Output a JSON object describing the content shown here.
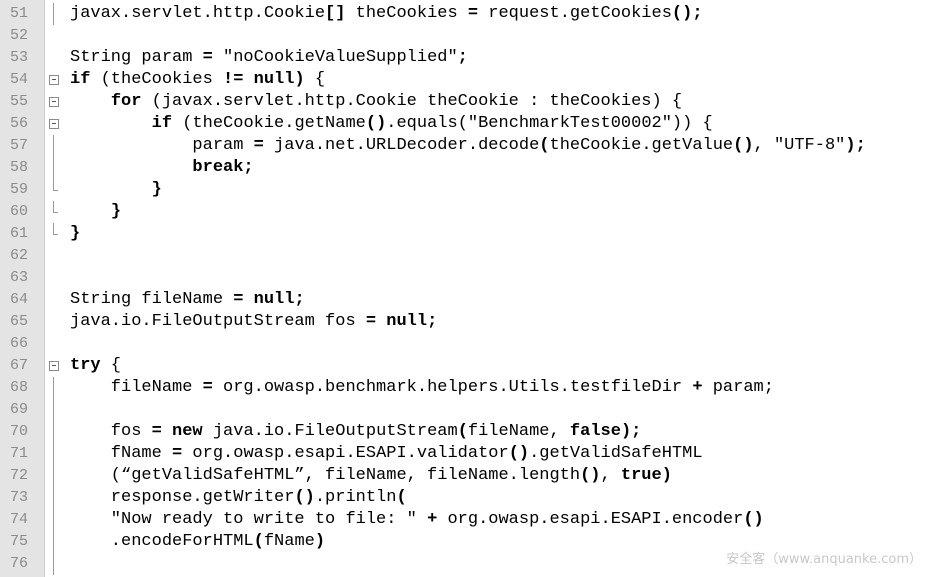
{
  "editor": {
    "watermark": "安全客（www.anquanke.com）",
    "lines": [
      {
        "num": "51",
        "fold": "vline",
        "segs": [
          {
            "t": "javax.servlet.http.Cookie"
          },
          {
            "t": "[]",
            "b": true
          },
          {
            "t": " theCookies "
          },
          {
            "t": "=",
            "b": true
          },
          {
            "t": " request.getCookies"
          },
          {
            "t": "();",
            "b": true
          }
        ]
      },
      {
        "num": "52",
        "fold": "",
        "segs": []
      },
      {
        "num": "53",
        "fold": "",
        "segs": [
          {
            "t": "String param "
          },
          {
            "t": "=",
            "b": true
          },
          {
            "t": " \"noCookieValueSupplied\""
          },
          {
            "t": ";",
            "b": true
          }
        ]
      },
      {
        "num": "54",
        "fold": "box",
        "segs": [
          {
            "t": "if",
            "b": true
          },
          {
            "t": " (theCookies "
          },
          {
            "t": "!=",
            "b": true
          },
          {
            "t": " "
          },
          {
            "t": "null",
            "b": true
          },
          {
            "t": ")",
            "b": true
          },
          {
            "t": " {"
          }
        ]
      },
      {
        "num": "55",
        "fold": "box",
        "segs": [
          {
            "t": "    "
          },
          {
            "t": "for",
            "b": true
          },
          {
            "t": " (javax.servlet.http.Cookie theCookie : theCookies) {"
          }
        ]
      },
      {
        "num": "56",
        "fold": "box",
        "segs": [
          {
            "t": "        "
          },
          {
            "t": "if",
            "b": true
          },
          {
            "t": " (theCookie.getName"
          },
          {
            "t": "()",
            "b": true
          },
          {
            "t": ".equals(\"BenchmarkTest00002\"))"
          },
          {
            "t": " {"
          }
        ]
      },
      {
        "num": "57",
        "fold": "vline",
        "segs": [
          {
            "t": "            param "
          },
          {
            "t": "=",
            "b": true
          },
          {
            "t": " java.net.URLDecoder.decode"
          },
          {
            "t": "(",
            "b": true
          },
          {
            "t": "theCookie.getValue"
          },
          {
            "t": "()",
            "b": true
          },
          {
            "t": ", \"UTF-8\""
          },
          {
            "t": ");",
            "b": true
          }
        ]
      },
      {
        "num": "58",
        "fold": "vline",
        "segs": [
          {
            "t": "            "
          },
          {
            "t": "break;",
            "b": true
          }
        ]
      },
      {
        "num": "59",
        "fold": "end",
        "segs": [
          {
            "t": "        "
          },
          {
            "t": "}",
            "b": true
          }
        ]
      },
      {
        "num": "60",
        "fold": "end",
        "segs": [
          {
            "t": "    "
          },
          {
            "t": "}",
            "b": true
          }
        ]
      },
      {
        "num": "61",
        "fold": "end",
        "segs": [
          {
            "t": "}",
            "b": true
          }
        ]
      },
      {
        "num": "62",
        "fold": "",
        "segs": []
      },
      {
        "num": "63",
        "fold": "",
        "segs": []
      },
      {
        "num": "64",
        "fold": "",
        "segs": [
          {
            "t": "String fileName "
          },
          {
            "t": "=",
            "b": true
          },
          {
            "t": " "
          },
          {
            "t": "null;",
            "b": true
          }
        ]
      },
      {
        "num": "65",
        "fold": "",
        "segs": [
          {
            "t": "java.io.FileOutputStream fos "
          },
          {
            "t": "=",
            "b": true
          },
          {
            "t": " "
          },
          {
            "t": "null;",
            "b": true
          }
        ]
      },
      {
        "num": "66",
        "fold": "",
        "segs": []
      },
      {
        "num": "67",
        "fold": "box",
        "segs": [
          {
            "t": "try",
            "b": true
          },
          {
            "t": " {"
          }
        ]
      },
      {
        "num": "68",
        "fold": "vline",
        "segs": [
          {
            "t": "    fileName "
          },
          {
            "t": "=",
            "b": true
          },
          {
            "t": " org.owasp.benchmark.helpers.Utils.testfileDir "
          },
          {
            "t": "+",
            "b": true
          },
          {
            "t": " param;"
          }
        ]
      },
      {
        "num": "69",
        "fold": "vline",
        "segs": []
      },
      {
        "num": "70",
        "fold": "vline",
        "segs": [
          {
            "t": "    fos "
          },
          {
            "t": "=",
            "b": true
          },
          {
            "t": " "
          },
          {
            "t": "new",
            "b": true
          },
          {
            "t": " java.io.FileOutputStream"
          },
          {
            "t": "(",
            "b": true
          },
          {
            "t": "fileName, "
          },
          {
            "t": "false",
            "b": true
          },
          {
            "t": ");",
            "b": true
          }
        ]
      },
      {
        "num": "71",
        "fold": "vline",
        "segs": [
          {
            "t": "    fName "
          },
          {
            "t": "=",
            "b": true
          },
          {
            "t": " org.owasp.esapi.ESAPI.validator"
          },
          {
            "t": "()",
            "b": true
          },
          {
            "t": ".getValidSafeHTML"
          }
        ]
      },
      {
        "num": "72",
        "fold": "vline",
        "segs": [
          {
            "t": "    (“getValidSafeHTML”, fileName, fileName.length"
          },
          {
            "t": "()",
            "b": true
          },
          {
            "t": ", "
          },
          {
            "t": "true",
            "b": true
          },
          {
            "t": ")",
            "b": true
          }
        ]
      },
      {
        "num": "73",
        "fold": "vline",
        "segs": [
          {
            "t": "    response.getWriter"
          },
          {
            "t": "()",
            "b": true
          },
          {
            "t": ".println"
          },
          {
            "t": "(",
            "b": true
          }
        ]
      },
      {
        "num": "74",
        "fold": "vline",
        "segs": [
          {
            "t": "    \"Now ready to write to file: \" "
          },
          {
            "t": "+",
            "b": true
          },
          {
            "t": " org.owasp.esapi.ESAPI.encoder"
          },
          {
            "t": "()",
            "b": true
          }
        ]
      },
      {
        "num": "75",
        "fold": "vline",
        "segs": [
          {
            "t": "    .encodeForHTML"
          },
          {
            "t": "(",
            "b": true
          },
          {
            "t": "fName"
          },
          {
            "t": ")",
            "b": true
          }
        ]
      },
      {
        "num": "76",
        "fold": "vline",
        "segs": []
      }
    ]
  }
}
